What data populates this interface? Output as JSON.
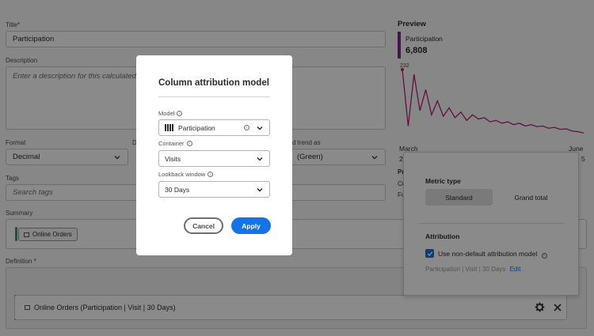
{
  "form": {
    "title_label": "Title",
    "title_value": "Participation",
    "description_label": "Description",
    "description_placeholder": "Enter a description for this calculated metr",
    "format_label": "Format",
    "format_value": "Decimal",
    "decimal_label": "D",
    "trend_label": "d trend as",
    "trend_value": "(Green)",
    "tags_label": "Tags",
    "tags_placeholder": "Search tags",
    "summary_label": "Summary",
    "summary_tag": "Online Orders",
    "definition_label": "Definition",
    "definition_row": "Online Orders (Participation | Visit | 30 Days)"
  },
  "preview": {
    "title": "Preview",
    "metric": "Participation",
    "value": "6,808",
    "chart_label": "232",
    "x_start": "March",
    "x_end": "June",
    "x_start_num": "2",
    "x_end_num": "5",
    "peek_p": "Pr",
    "peek_cu": "Cu",
    "peek_fu": "Fu"
  },
  "popover": {
    "metric_type_label": "Metric type",
    "standard_label": "Standard",
    "grand_total_label": "Grand total",
    "attribution_label": "Attribution",
    "non_default_label": "Use non-default attribution model",
    "summary_text": "Participation | Visit | 30 Days",
    "edit_label": "Edit"
  },
  "modal": {
    "title": "Column attribution model",
    "model_label": "Model",
    "model_value": "Participation",
    "container_label": "Container",
    "container_value": "Visits",
    "lookback_label": "Lookback window",
    "lookback_value": "30 Days",
    "cancel_label": "Cancel",
    "apply_label": "Apply"
  },
  "chart_data": {
    "type": "line",
    "title": "",
    "color": "#b3207a",
    "data_label": "232",
    "values": [
      232,
      30,
      215,
      85,
      160,
      70,
      120,
      65,
      95,
      60,
      80,
      50,
      70,
      55,
      60,
      45,
      50,
      40,
      45,
      35,
      40,
      30,
      35,
      28,
      30,
      22,
      25,
      18,
      20,
      12,
      10,
      5
    ],
    "x_labels": [
      "March",
      "June"
    ]
  },
  "colors": {
    "accent": "#1473e6",
    "metric_bar": "#7b2d86",
    "component_green": "#2d9d78"
  }
}
